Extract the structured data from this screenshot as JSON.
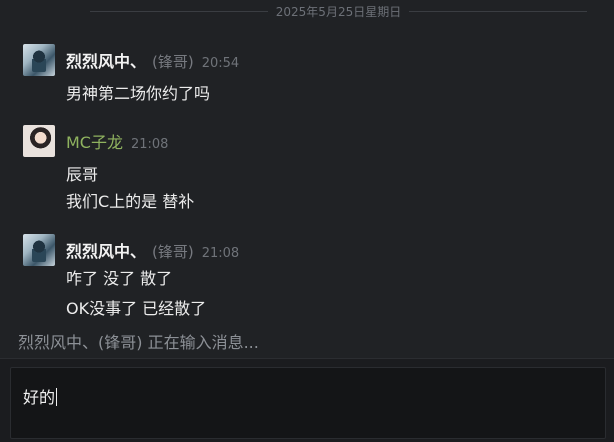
{
  "date_divider": "2025年5月25日星期日",
  "messages": [
    {
      "sender": "烈烈风中、",
      "alias": "(锋哥)",
      "time": "20:54",
      "lines": [
        "男神第二场你约了吗"
      ],
      "avatar_icon": "anime-avatar-icon"
    },
    {
      "sender": "MC子龙",
      "alias": "",
      "time": "21:08",
      "lines": [
        "辰哥",
        "我们C上的是 替补"
      ],
      "avatar_icon": "photo-avatar-icon"
    },
    {
      "sender": "烈烈风中、",
      "alias": "(锋哥)",
      "time": "21:08",
      "lines": [
        "咋了 没了 散了",
        "OK没事了 已经散了"
      ],
      "avatar_icon": "anime-avatar-icon"
    }
  ],
  "typing_status": "烈烈风中、(锋哥) 正在输入消息...",
  "composer": {
    "value": "好的"
  },
  "colors": {
    "background": "#202225",
    "name_default": "#f2f2f2",
    "name_green": "#8fb35f",
    "muted": "#777a80"
  }
}
